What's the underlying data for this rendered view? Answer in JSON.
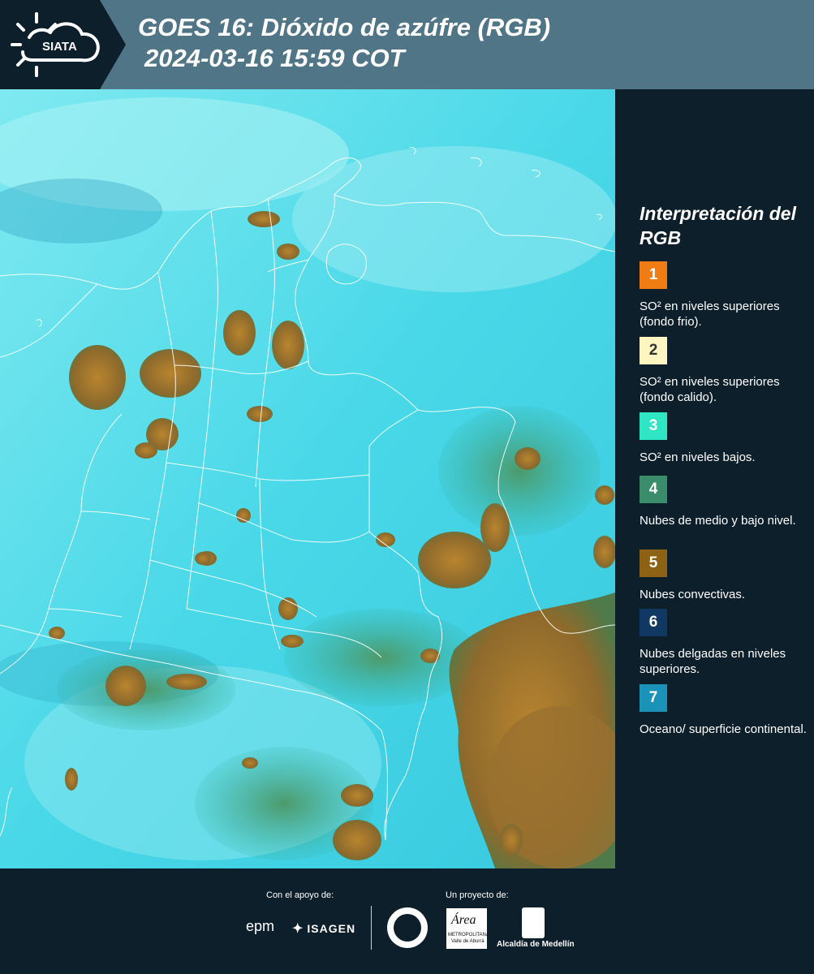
{
  "header": {
    "logo_text": "SIATA",
    "title_line1": "GOES 16: Dióxido de azúfre (RGB)",
    "title_line2": "2024-03-16 15:59 COT"
  },
  "legend": {
    "title": "Interpretación del RGB",
    "items": [
      {
        "number": "1",
        "color": "#f07d14",
        "text_color": "#ffffff",
        "description": "SO² en niveles superiores (fondo frio)."
      },
      {
        "number": "2",
        "color": "#fdf6c2",
        "text_color": "#333333",
        "description": "SO² en niveles superiores (fondo calido)."
      },
      {
        "number": "3",
        "color": "#2fe6c4",
        "text_color": "#ffffff",
        "description": "SO² en niveles bajos."
      },
      {
        "number": "4",
        "color": "#3a8d6a",
        "text_color": "#ffffff",
        "description": "Nubes de medio y bajo nivel."
      },
      {
        "number": "5",
        "color": "#8e6214",
        "text_color": "#ffffff",
        "description": "Nubes convectivas."
      },
      {
        "number": "6",
        "color": "#113763",
        "text_color": "#ffffff",
        "description": "Nubes delgadas en niveles superiores."
      },
      {
        "number": "7",
        "color": "#1b93b8",
        "text_color": "#ffffff",
        "description": "Oceano/ superficie continental."
      }
    ]
  },
  "footer": {
    "support_label": "Con el apoyo de:",
    "project_label": "Un proyecto de:",
    "sponsor1": "epm",
    "sponsor2": "ISAGEN",
    "org_area": "Área",
    "org_area_sub1": "METROPOLITANA",
    "org_area_sub2": "Valle de Aburrá",
    "org_alcaldia": "Alcaldía de Medellín"
  },
  "colors": {
    "header_bg": "#4f7587",
    "panel_bg": "#0e1f2c",
    "map_base": "#3fd6e6",
    "cloud_convective": "#8e6a2c",
    "cloud_low": "#3a8d6a"
  }
}
